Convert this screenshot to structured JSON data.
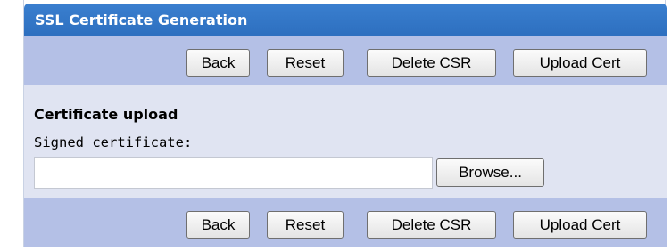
{
  "header": {
    "title": "SSL Certificate Generation"
  },
  "toolbar_top": {
    "back_label": "Back",
    "reset_label": "Reset",
    "delete_csr_label": "Delete CSR",
    "upload_cert_label": "Upload Cert"
  },
  "section": {
    "title": "Certificate upload",
    "field_label": "Signed certificate:",
    "field_value": "",
    "browse_label": "Browse..."
  },
  "toolbar_bottom": {
    "back_label": "Back",
    "reset_label": "Reset",
    "delete_csr_label": "Delete CSR",
    "upload_cert_label": "Upload Cert"
  },
  "colors": {
    "header_bg": "#2f73c5",
    "toolbar_bg": "#b4c0e6",
    "content_bg": "#e0e4f2"
  }
}
